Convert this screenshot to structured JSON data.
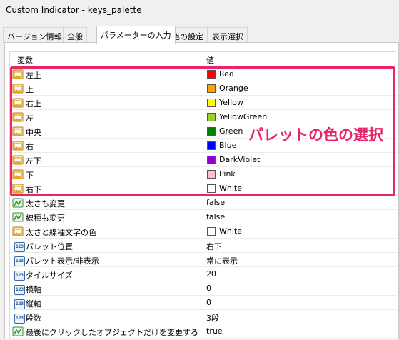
{
  "window": {
    "title": "Custom Indicator - keys_palette"
  },
  "tabs": [
    {
      "label": "バージョン情報"
    },
    {
      "label": "全般"
    },
    {
      "label": "パラメーターの入力"
    },
    {
      "label": "色の設定"
    },
    {
      "label": "表示選択"
    }
  ],
  "grid": {
    "headers": {
      "name": "変数",
      "value": "値"
    },
    "rows": [
      {
        "name": "左上",
        "value": "Red",
        "icon": "color-param-icon",
        "swatch": "#ff0000"
      },
      {
        "name": "上",
        "value": "Orange",
        "icon": "color-param-icon",
        "swatch": "#ffa500"
      },
      {
        "name": "右上",
        "value": "Yellow",
        "icon": "color-param-icon",
        "swatch": "#ffff00"
      },
      {
        "name": "左",
        "value": "YellowGreen",
        "icon": "color-param-icon",
        "swatch": "#9acd32"
      },
      {
        "name": "中央",
        "value": "Green",
        "icon": "color-param-icon",
        "swatch": "#008000"
      },
      {
        "name": "右",
        "value": "Blue",
        "icon": "color-param-icon",
        "swatch": "#0000ff"
      },
      {
        "name": "左下",
        "value": "DarkViolet",
        "icon": "color-param-icon",
        "swatch": "#9400d3"
      },
      {
        "name": "下",
        "value": "Pink",
        "icon": "color-param-icon",
        "swatch": "#ffc0cb"
      },
      {
        "name": "右下",
        "value": "White",
        "icon": "color-param-icon",
        "swatch": "#ffffff"
      },
      {
        "name": "太さも変更",
        "value": "false",
        "icon": "bool-param-icon"
      },
      {
        "name": "線種も変更",
        "value": "false",
        "icon": "bool-param-icon"
      },
      {
        "name": "太さと線種文字の色",
        "value": "White",
        "icon": "color-param-icon",
        "swatch": "#ffffff"
      },
      {
        "name": "パレット位置",
        "value": "右下",
        "icon": "number-param-icon"
      },
      {
        "name": "パレット表示/非表示",
        "value": "常に表示",
        "icon": "number-param-icon"
      },
      {
        "name": "タイルサイズ",
        "value": "20",
        "icon": "number-param-icon"
      },
      {
        "name": "横軸",
        "value": "0",
        "icon": "number-param-icon"
      },
      {
        "name": "縦軸",
        "value": "0",
        "icon": "number-param-icon"
      },
      {
        "name": "段数",
        "value": "3段",
        "icon": "number-param-icon"
      },
      {
        "name": "最後にクリックしたオブジェクトだけを変更する",
        "value": "true",
        "icon": "bool-param-icon"
      }
    ]
  },
  "annotation": {
    "text": "パレットの色の選択",
    "color": "#e8246b"
  },
  "icons": {
    "number_badge": "123"
  }
}
